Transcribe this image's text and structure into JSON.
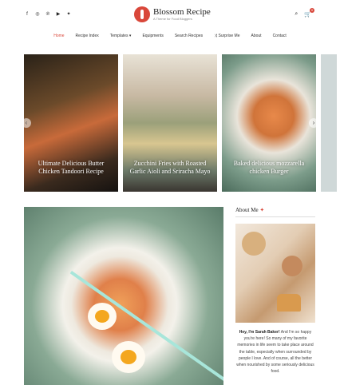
{
  "header": {
    "social_icons": [
      "facebook-icon",
      "instagram-icon",
      "pinterest-icon",
      "youtube-icon",
      "twitter-icon"
    ],
    "logo_title": "Blossom Recipe",
    "logo_tagline": "A Theme for Food Bloggers",
    "cart_count": "0"
  },
  "nav": {
    "items": [
      "Home",
      "Recipe Index",
      "Templates",
      "Equipments",
      "Search Recipes",
      "Surprise Me",
      "About",
      "Contact"
    ]
  },
  "slider": {
    "slides": [
      {
        "caption": "Ultimate Delicious Butter Chicken Tandoori Recipe"
      },
      {
        "caption": "Zucchini Fries with Roasted Garlic Aioli and Sriracha Mayo"
      },
      {
        "caption": "Baked delicious mozzarella chicken Burger"
      }
    ]
  },
  "about": {
    "title": "About Me",
    "text_bold": "Hey, I'm Sarah Baker!",
    "text": "And I'm so happy you're here! So many of my favorite memories in life seem to take place around the table, especially when surrounded by people I love. And of course, all the better when nourished by some seriously delicious food."
  },
  "colors": {
    "accent": "#d9473a"
  }
}
